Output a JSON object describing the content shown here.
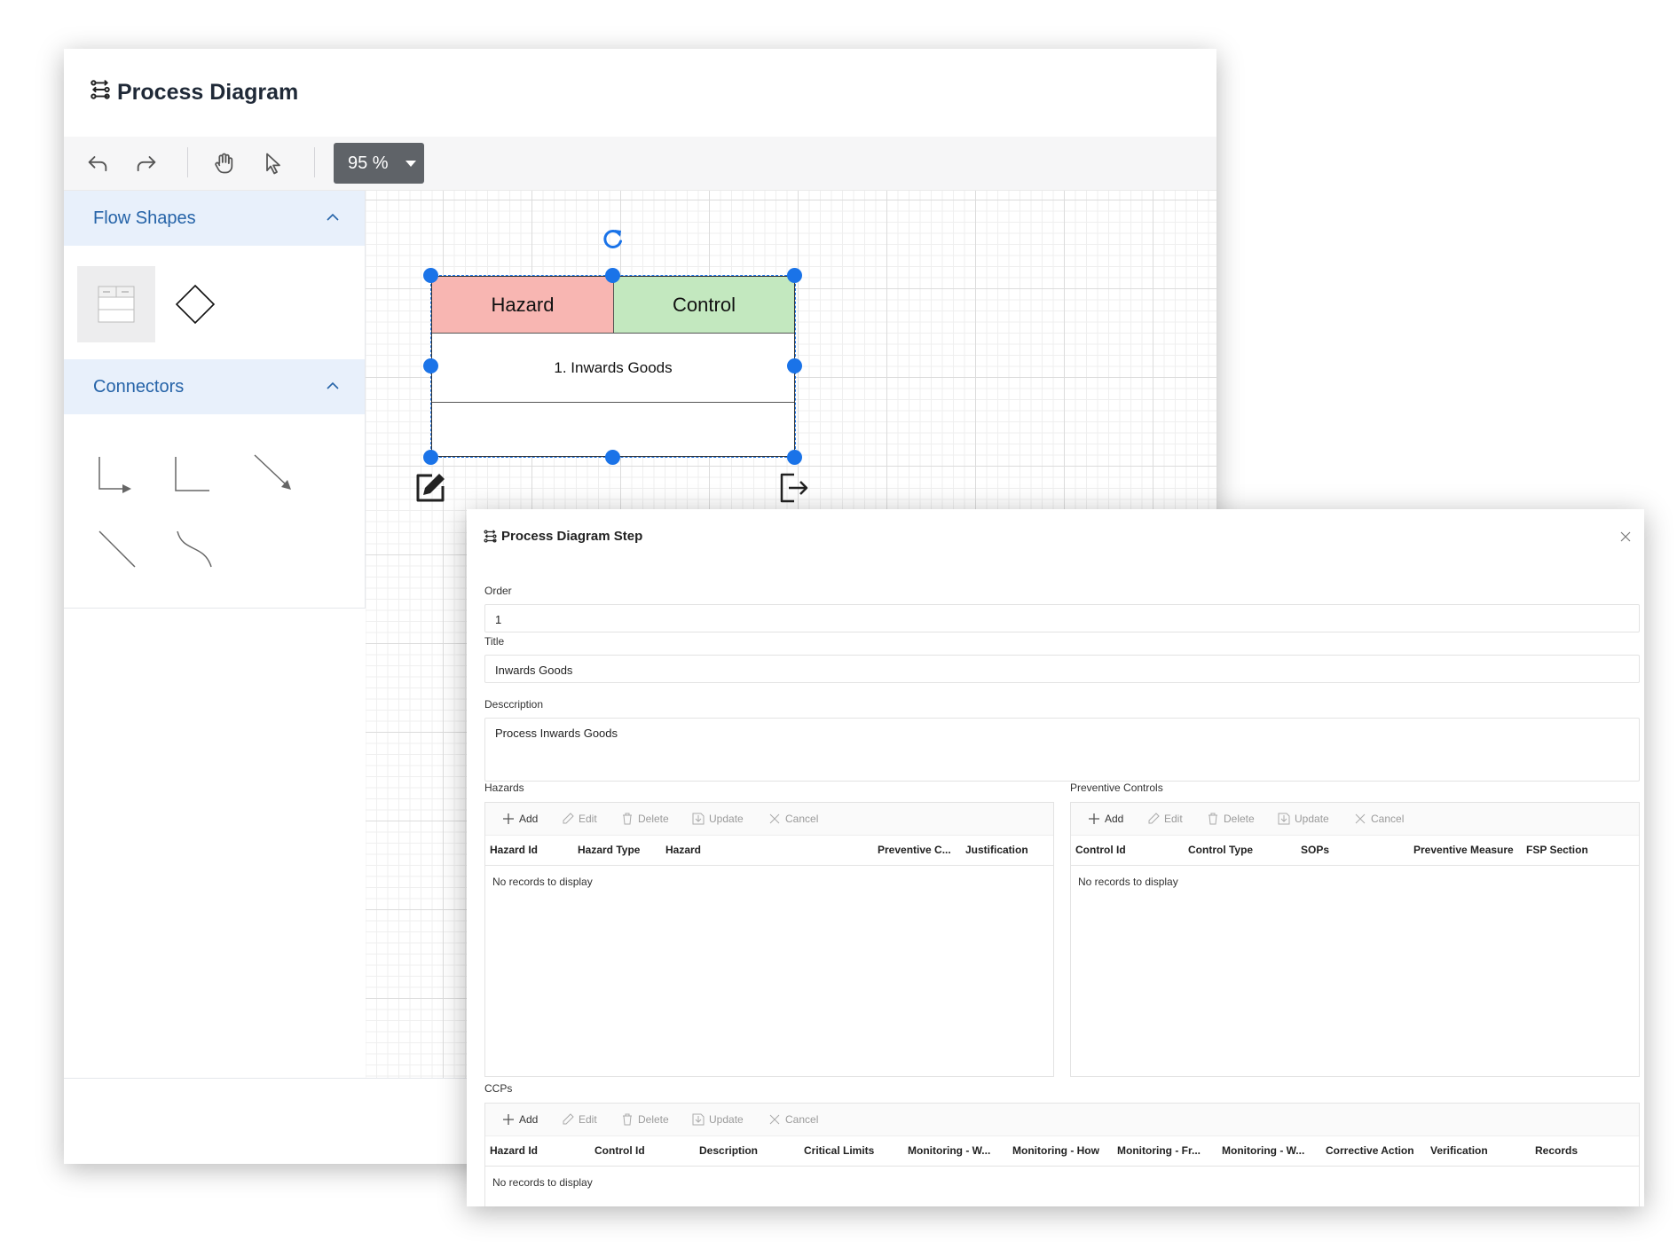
{
  "app": {
    "title": "Process Diagram"
  },
  "toolbar": {
    "zoom_label": "95 %"
  },
  "palette": {
    "flow_shapes_label": "Flow Shapes",
    "connectors_label": "Connectors"
  },
  "node": {
    "hazard_label": "Hazard",
    "control_label": "Control",
    "step_title": "1. Inwards Goods"
  },
  "dialog": {
    "title": "Process Diagram Step",
    "order_label": "Order",
    "order_value": "1",
    "title_label": "Title",
    "title_value": "Inwards Goods",
    "description_label": "Desccription",
    "description_value": "Process Inwards Goods",
    "grid_tools": {
      "add": "Add",
      "edit": "Edit",
      "delete": "Delete",
      "update": "Update",
      "cancel": "Cancel"
    },
    "empty_text": "No records to display",
    "hazards": {
      "label": "Hazards",
      "columns": [
        "Hazard Id",
        "Hazard Type",
        "Hazard",
        "Preventive C...",
        "Justification"
      ]
    },
    "controls": {
      "label": "Preventive Controls",
      "columns": [
        "Control Id",
        "Control Type",
        "SOPs",
        "Preventive Measure",
        "FSP Section"
      ]
    },
    "ccps": {
      "label": "CCPs",
      "columns": [
        "Hazard Id",
        "Control Id",
        "Description",
        "Critical Limits",
        "Monitoring - W...",
        "Monitoring - How",
        "Monitoring - Fr...",
        "Monitoring - W...",
        "Corrective Action",
        "Verification",
        "Records"
      ]
    }
  },
  "colors": {
    "accent": "#1a73e8",
    "hazard_fill": "#f8b6b2",
    "control_fill": "#c3e8bf",
    "palette_header": "#e8f0fb",
    "zoom_bg": "#5f6368"
  }
}
